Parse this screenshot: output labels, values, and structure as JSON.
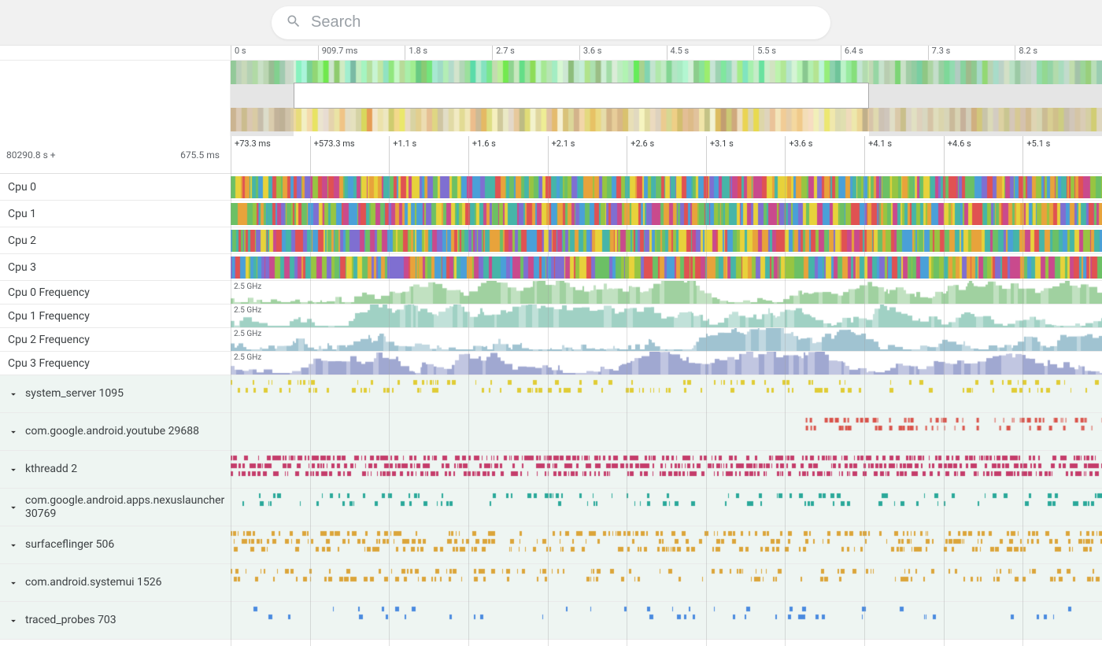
{
  "search": {
    "placeholder": "Search"
  },
  "ruler_top": [
    "0 s",
    "909.7 ms",
    "1.8 s",
    "2.7 s",
    "3.6 s",
    "4.5 s",
    "5.5 s",
    "6.4 s",
    "7.3 s",
    "8.2 s"
  ],
  "time_base": "80290.8 s +",
  "time_offset": "675.5 ms",
  "ruler_zoom": [
    "+73.3 ms",
    "+573.3 ms",
    "+1.1 s",
    "+1.6 s",
    "+2.1 s",
    "+2.6 s",
    "+3.1 s",
    "+3.6 s",
    "+4.1 s",
    "+4.6 s",
    "+5.1 s"
  ],
  "overview_window": {
    "start_pct": 7.2,
    "end_pct": 73.3
  },
  "cpu_tracks": [
    {
      "name": "Cpu 0"
    },
    {
      "name": "Cpu 1"
    },
    {
      "name": "Cpu 2"
    },
    {
      "name": "Cpu 3"
    }
  ],
  "freq_tracks": [
    {
      "name": "Cpu 0 Frequency",
      "label": "2.5 GHz",
      "color": "#8fc98f"
    },
    {
      "name": "Cpu 1 Frequency",
      "label": "2.5 GHz",
      "color": "#8fc9ba"
    },
    {
      "name": "Cpu 2 Frequency",
      "label": "2.5 GHz",
      "color": "#8fb8c9"
    },
    {
      "name": "Cpu 3 Frequency",
      "label": "2.5 GHz",
      "color": "#8f99c9"
    }
  ],
  "processes": [
    {
      "name": "system_server 1095",
      "color": "#e0cc36",
      "density": 0.35,
      "rows": 2,
      "seed": 11
    },
    {
      "name": "com.google.android.youtube 29688",
      "color": "#d9534a",
      "density": 0.45,
      "rows": 2,
      "seed": 22,
      "start_pct": 66
    },
    {
      "name": "kthreadd 2",
      "color": "#c43d6b",
      "density": 0.75,
      "rows": 3,
      "seed": 33
    },
    {
      "name": "com.google.android.apps.nexuslauncher 30769",
      "color": "#2aa89a",
      "density": 0.25,
      "rows": 2,
      "seed": 44
    },
    {
      "name": "surfaceflinger 506",
      "color": "#dba53a",
      "density": 0.45,
      "rows": 3,
      "seed": 55
    },
    {
      "name": "com.android.systemui 1526",
      "color": "#dba53a",
      "density": 0.3,
      "rows": 2,
      "seed": 66
    },
    {
      "name": "traced_probes 703",
      "color": "#4a8adf",
      "density": 0.1,
      "rows": 2,
      "seed": 77
    }
  ],
  "palette": [
    "#e05252",
    "#e8a33b",
    "#e7d23b",
    "#6cc065",
    "#4aa0d8",
    "#7f6fd1",
    "#c94a8d",
    "#46b5a8",
    "#97c542"
  ]
}
